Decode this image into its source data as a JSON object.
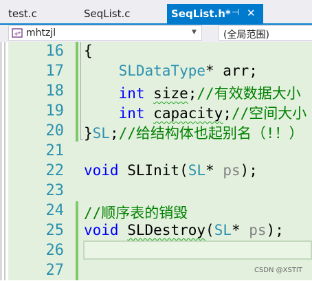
{
  "tabs": {
    "items": [
      {
        "label": "test.c"
      },
      {
        "label": "SeqList.c"
      },
      {
        "label": "SeqList.h*"
      }
    ],
    "pin_icon": "⊣",
    "close_icon": "✕"
  },
  "nav": {
    "scope_value": "mhtzjl",
    "member_value": "(全局范围)",
    "dropdown_icon": "chevron-down-icon"
  },
  "editor": {
    "lines": [
      {
        "num": "16",
        "tokens": [
          {
            "t": "{",
            "c": "p"
          }
        ]
      },
      {
        "num": "17",
        "tokens": [
          {
            "t": "    ",
            "c": "p"
          },
          {
            "t": "SLDataType",
            "c": "ty"
          },
          {
            "t": "* arr;",
            "c": "p"
          }
        ]
      },
      {
        "num": "18",
        "tokens": [
          {
            "t": "    ",
            "c": "p"
          },
          {
            "t": "int",
            "c": "kw"
          },
          {
            "t": " ",
            "c": "p"
          },
          {
            "t": "size",
            "c": "sq"
          },
          {
            "t": ";",
            "c": "p"
          },
          {
            "t": "//有效数据大小",
            "c": "cm"
          }
        ]
      },
      {
        "num": "19",
        "tokens": [
          {
            "t": "    ",
            "c": "p"
          },
          {
            "t": "int",
            "c": "kw"
          },
          {
            "t": " ",
            "c": "p"
          },
          {
            "t": "capacity",
            "c": "sq"
          },
          {
            "t": ";",
            "c": "p"
          },
          {
            "t": "//空间大小",
            "c": "cm"
          }
        ]
      },
      {
        "num": "20",
        "tokens": [
          {
            "t": "}",
            "c": "p"
          },
          {
            "t": "SL",
            "c": "ty"
          },
          {
            "t": ";",
            "c": "p"
          },
          {
            "t": "//给结构体也起别名（!！）",
            "c": "cm"
          }
        ]
      },
      {
        "num": "21",
        "tokens": []
      },
      {
        "num": "22",
        "tokens": [
          {
            "t": "void",
            "c": "kw"
          },
          {
            "t": " SLInit(",
            "c": "p"
          },
          {
            "t": "SL",
            "c": "ty"
          },
          {
            "t": "* ",
            "c": "p"
          },
          {
            "t": "ps",
            "c": "pm"
          },
          {
            "t": ");",
            "c": "p"
          }
        ]
      },
      {
        "num": "23",
        "tokens": []
      },
      {
        "num": "24",
        "tokens": [
          {
            "t": "//顺序表的销毁",
            "c": "cm"
          }
        ]
      },
      {
        "num": "25",
        "tokens": [
          {
            "t": "void",
            "c": "kw"
          },
          {
            "t": " ",
            "c": "p"
          },
          {
            "t": "SLDestroy",
            "c": "sq"
          },
          {
            "t": "(",
            "c": "p"
          },
          {
            "t": "SL",
            "c": "ty"
          },
          {
            "t": "* ",
            "c": "p"
          },
          {
            "t": "ps",
            "c": "pm"
          },
          {
            "t": ");",
            "c": "p"
          }
        ]
      },
      {
        "num": "26",
        "tokens": []
      },
      {
        "num": "27",
        "tokens": []
      }
    ]
  },
  "watermark": "CSDN @XSTIT",
  "colors": {
    "accent": "#007acc",
    "keyword": "#0000ff",
    "type": "#2b91af",
    "comment": "#008000",
    "param": "#808080",
    "line_number": "#2b91af",
    "change_bar": "#7fc96d",
    "editor_bg": "#e3f0de"
  }
}
